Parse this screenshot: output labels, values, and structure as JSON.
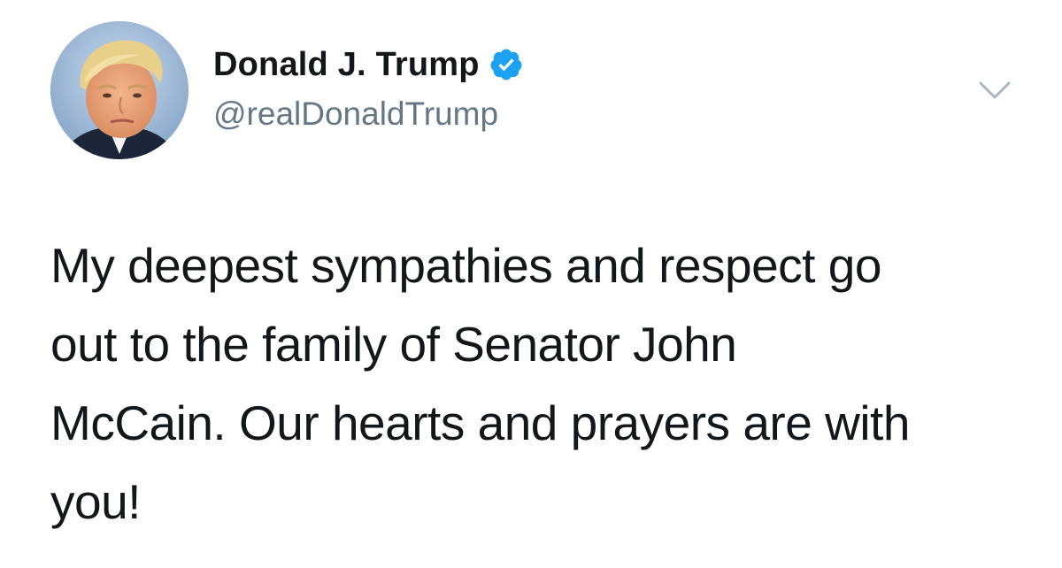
{
  "tweet": {
    "author": {
      "display_name": "Donald J. Trump",
      "handle": "@realDonaldTrump",
      "verified": true,
      "verified_icon": "verified-badge-icon",
      "avatar_icon": "profile-avatar"
    },
    "menu_icon": "chevron-down-icon",
    "text": "My deepest sympathies and respect go\nout to the family of Senator John\nMcCain. Our hearts and prayers are with\nyou!"
  },
  "colors": {
    "text_primary": "#14171a",
    "text_secondary": "#657786",
    "verified_blue": "#1da1f2",
    "background": "#ffffff",
    "caret_gray": "#aab8c2"
  }
}
